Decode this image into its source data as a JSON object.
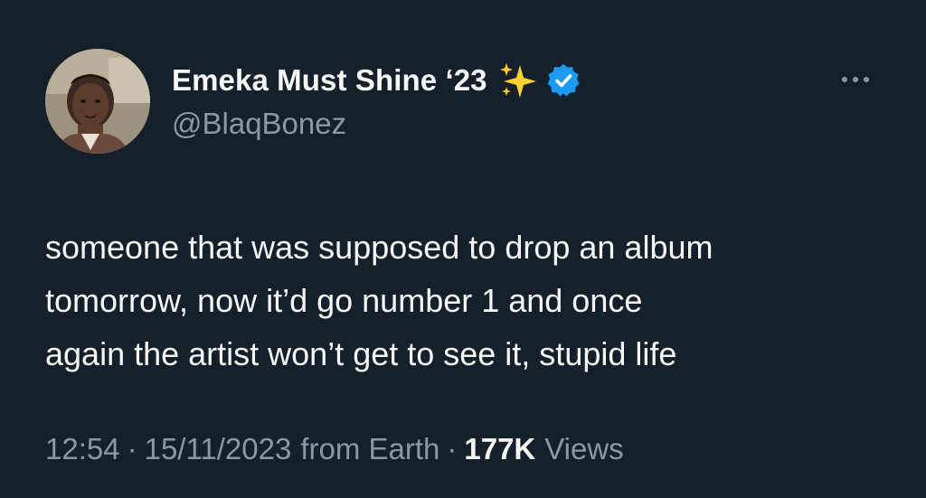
{
  "author": {
    "display_name": "Emeka Must Shine ‘23",
    "handle": "@BlaqBonez",
    "verified": true,
    "emoji_icon": "sparkles-icon",
    "badge_color": "#1d9bf0"
  },
  "tweet": {
    "text_lines": [
      "someone that was supposed to drop an album",
      "tomorrow, now it’d go number 1 and once",
      "again the artist won’t get to see it, stupid life"
    ]
  },
  "meta": {
    "time": "12:54",
    "separator": "·",
    "date": "15/11/2023",
    "source": "from Earth",
    "views_count": "177K",
    "views_label": "Views"
  },
  "colors": {
    "background": "#15202b",
    "primary_text": "#f7f9f9",
    "secondary_text": "#8b98a5",
    "accent": "#1d9bf0"
  }
}
